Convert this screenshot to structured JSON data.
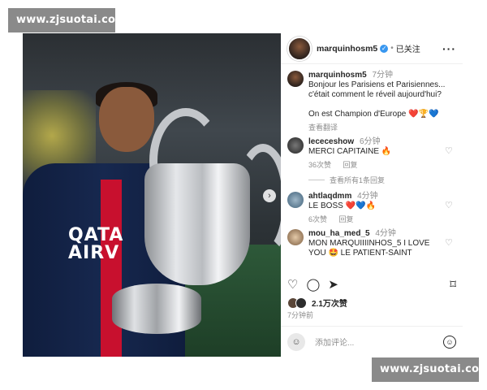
{
  "watermark": {
    "top": "www.zjsuotai.com",
    "bottom": "www.zjsuotai.com"
  },
  "post": {
    "header": {
      "username": "marquinhosm5",
      "verified_glyph": "✓",
      "separator": "•",
      "follow_status": "已关注",
      "more": "···"
    },
    "photo": {
      "shirt_text": "QATA\nAIRV",
      "next_glyph": "›"
    },
    "caption": {
      "username": "marquinhosm5",
      "time": "7分钟",
      "text": "Bonjour les Parisiens et Parisiennes...\nc'était comment le réveil aujourd'hui?\n\nOn est Champion d'Europe ❤️🏆💙",
      "translate": "查看翻译"
    },
    "comments": [
      {
        "username": "lececeshow",
        "time": "6分钟",
        "text": "MERCI CAPITAINE 🔥",
        "likes": "36次赞",
        "reply": "回复"
      },
      {
        "username": "ahtlaqdmm",
        "time": "4分钟",
        "text": "LE BOSS ❤️💙🔥",
        "likes": "6次赞",
        "reply": "回复"
      },
      {
        "username": "mou_ha_med_5",
        "time": "4分钟",
        "text": "MON MARQUIIIINHOS_5 I LOVE\nYOU 🤩 LE PATIENT-SAINT",
        "likes": "",
        "reply": ""
      }
    ],
    "view_replies": "查看所有1条回复",
    "heart_glyph": "♡",
    "actions": {
      "like": "♡",
      "comment": "◯",
      "share": "➤",
      "bookmark": "⌑"
    },
    "likes_count": "2.1万次赞",
    "posted_ago": "7分钟前",
    "add_comment_placeholder": "添加评论...",
    "emoji_glyph": "☺"
  }
}
